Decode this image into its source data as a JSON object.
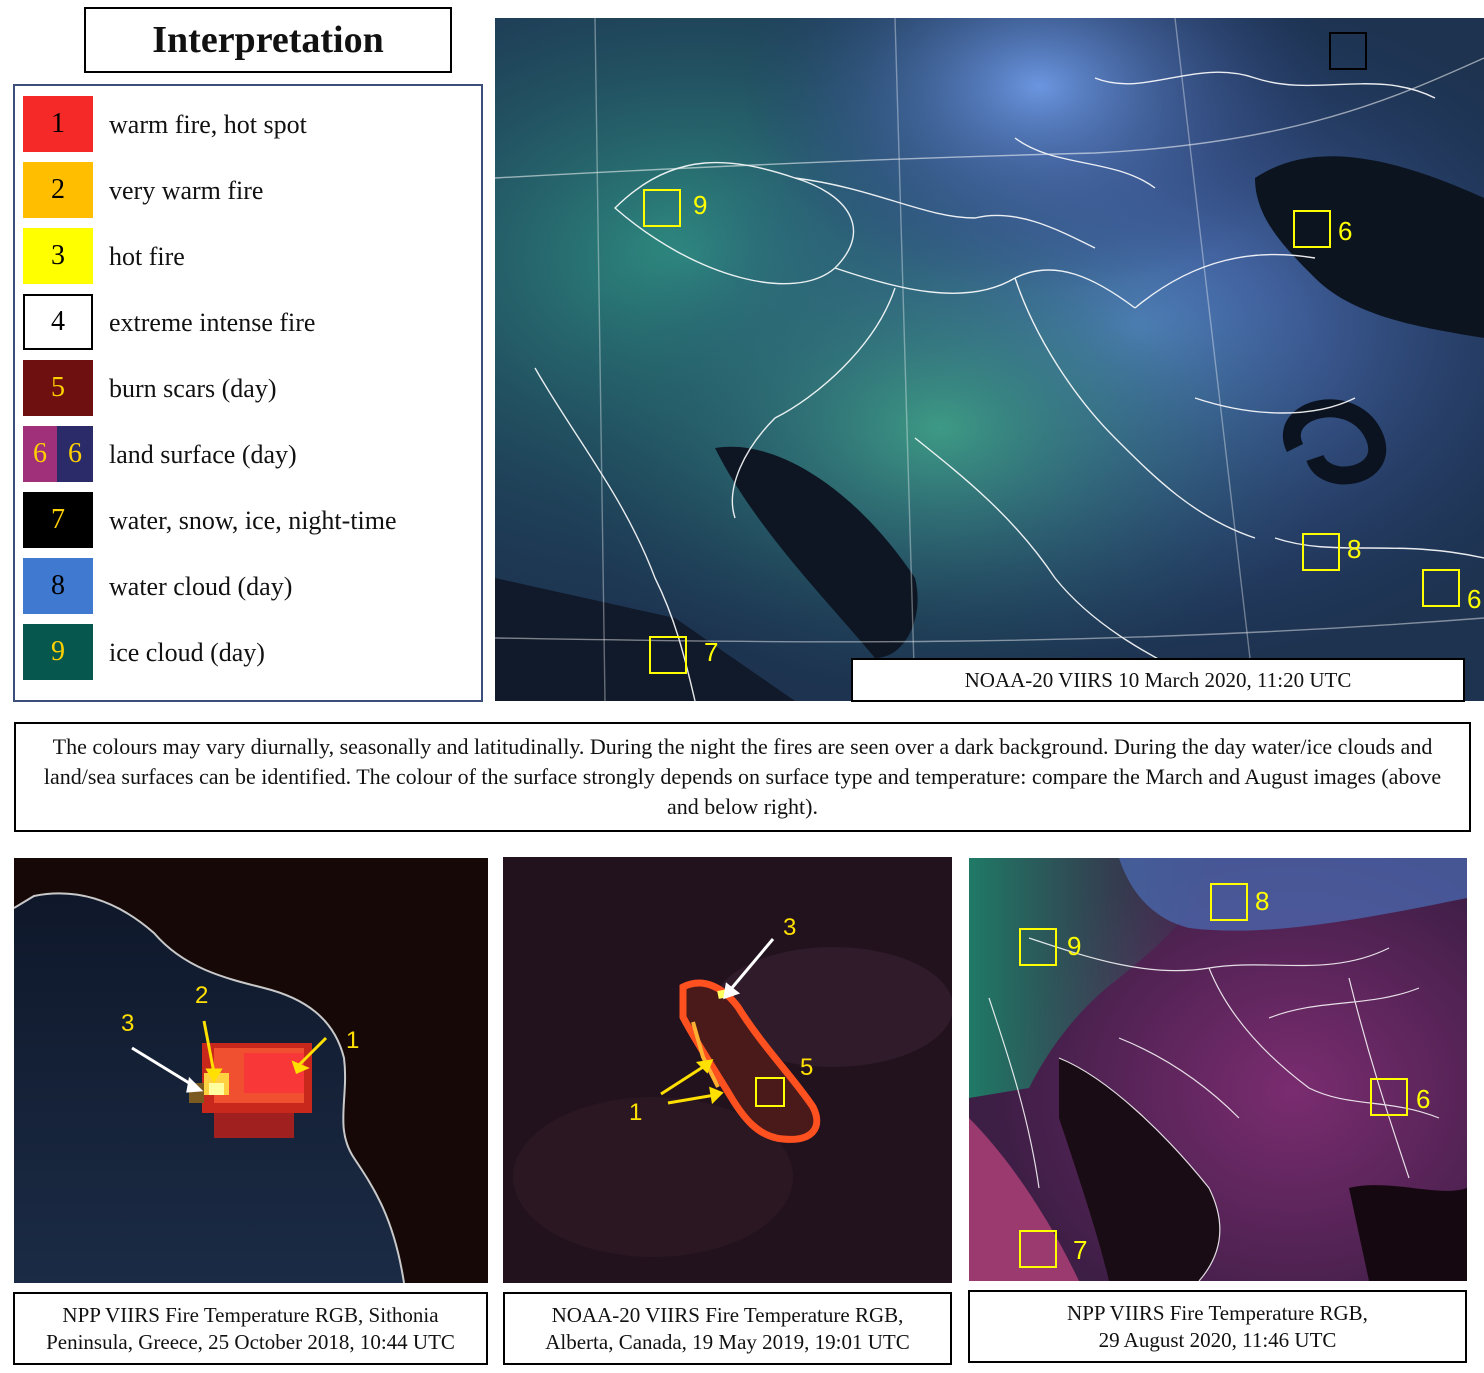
{
  "title": "Interpretation",
  "legend": [
    {
      "num": "1",
      "label": "warm fire, hot spot",
      "color": "#f52a28",
      "numColor": "#000000"
    },
    {
      "num": "2",
      "label": "very warm fire",
      "color": "#ffbe00",
      "numColor": "#000000"
    },
    {
      "num": "3",
      "label": "hot fire",
      "color": "#ffff00",
      "numColor": "#000000"
    },
    {
      "num": "4",
      "label": "extreme intense fire",
      "color": "#ffffff",
      "numColor": "#000000"
    },
    {
      "num": "5",
      "label": "burn scars (day)",
      "color": "#6e1010",
      "numColor": "#ffd000"
    },
    {
      "num": "6",
      "num2": "6",
      "label": "land surface (day)",
      "color": "#a0307a",
      "color2": "#2b2b6a",
      "numColor": "#ffd000"
    },
    {
      "num": "7",
      "label": "water, snow, ice, night-time",
      "color": "#000000",
      "numColor": "#ffd000"
    },
    {
      "num": "8",
      "label": "water cloud (day)",
      "color": "#3f7ad0",
      "numColor": "#000000"
    },
    {
      "num": "9",
      "label": "ice cloud (day)",
      "color": "#06584f",
      "numColor": "#ffd000"
    }
  ],
  "main_image": {
    "caption": "NOAA-20 VIIRS 10 March 2020, 11:20 UTC",
    "markers": [
      "9",
      "6",
      "8",
      "6",
      "7"
    ]
  },
  "note": "The colours may vary diurnally, seasonally and latitudinally. During the night the fires are seen over a dark background. During the day water/ice clouds and land/sea surfaces can be identified. The colour of the surface strongly depends on surface type and temperature: compare the March and August images (above and below right).",
  "panels": [
    {
      "caption_line1": "NPP VIIRS Fire Temperature RGB, Sithonia",
      "caption_line2": "Peninsula, Greece, 25 October 2018, 10:44 UTC",
      "labels": [
        "3",
        "2",
        "1"
      ]
    },
    {
      "caption_line1": "NOAA-20 VIIRS Fire Temperature RGB,",
      "caption_line2": "Alberta, Canada, 19 May 2019, 19:01 UTC",
      "labels": [
        "3",
        "5",
        "1"
      ]
    },
    {
      "caption_line1": "NPP VIIRS Fire Temperature RGB,",
      "caption_line2": "29 August 2020, 11:46 UTC",
      "labels": [
        "8",
        "9",
        "6",
        "7"
      ]
    }
  ]
}
